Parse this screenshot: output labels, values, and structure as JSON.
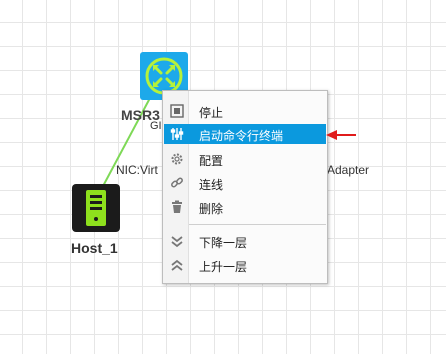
{
  "topology": {
    "router": {
      "label": "MSR3",
      "port": "GI"
    },
    "host": {
      "label": "Host_1"
    },
    "link": {
      "nic_left": "NIC:Virt",
      "nic_right": "Adapter"
    }
  },
  "context_menu": {
    "items": [
      {
        "label": "停止",
        "icon": "stop-icon",
        "selected": false
      },
      {
        "label": "启动命令行终端",
        "icon": "terminal-icon",
        "selected": true
      },
      {
        "label": "配置",
        "icon": "gear-icon",
        "selected": false
      },
      {
        "label": "连线",
        "icon": "link-icon",
        "selected": false
      },
      {
        "label": "删除",
        "icon": "trash-icon",
        "selected": false
      },
      {
        "label": "下降一层",
        "icon": "layer-down-icon",
        "selected": false
      },
      {
        "label": "上升一层",
        "icon": "layer-up-icon",
        "selected": false
      }
    ]
  },
  "colors": {
    "router_bg": "#1da9ea",
    "highlight": "#0b99de",
    "link_line": "#7ed957",
    "annotation_arrow": "#e01b1b",
    "host_bg": "#1b1b1b"
  }
}
